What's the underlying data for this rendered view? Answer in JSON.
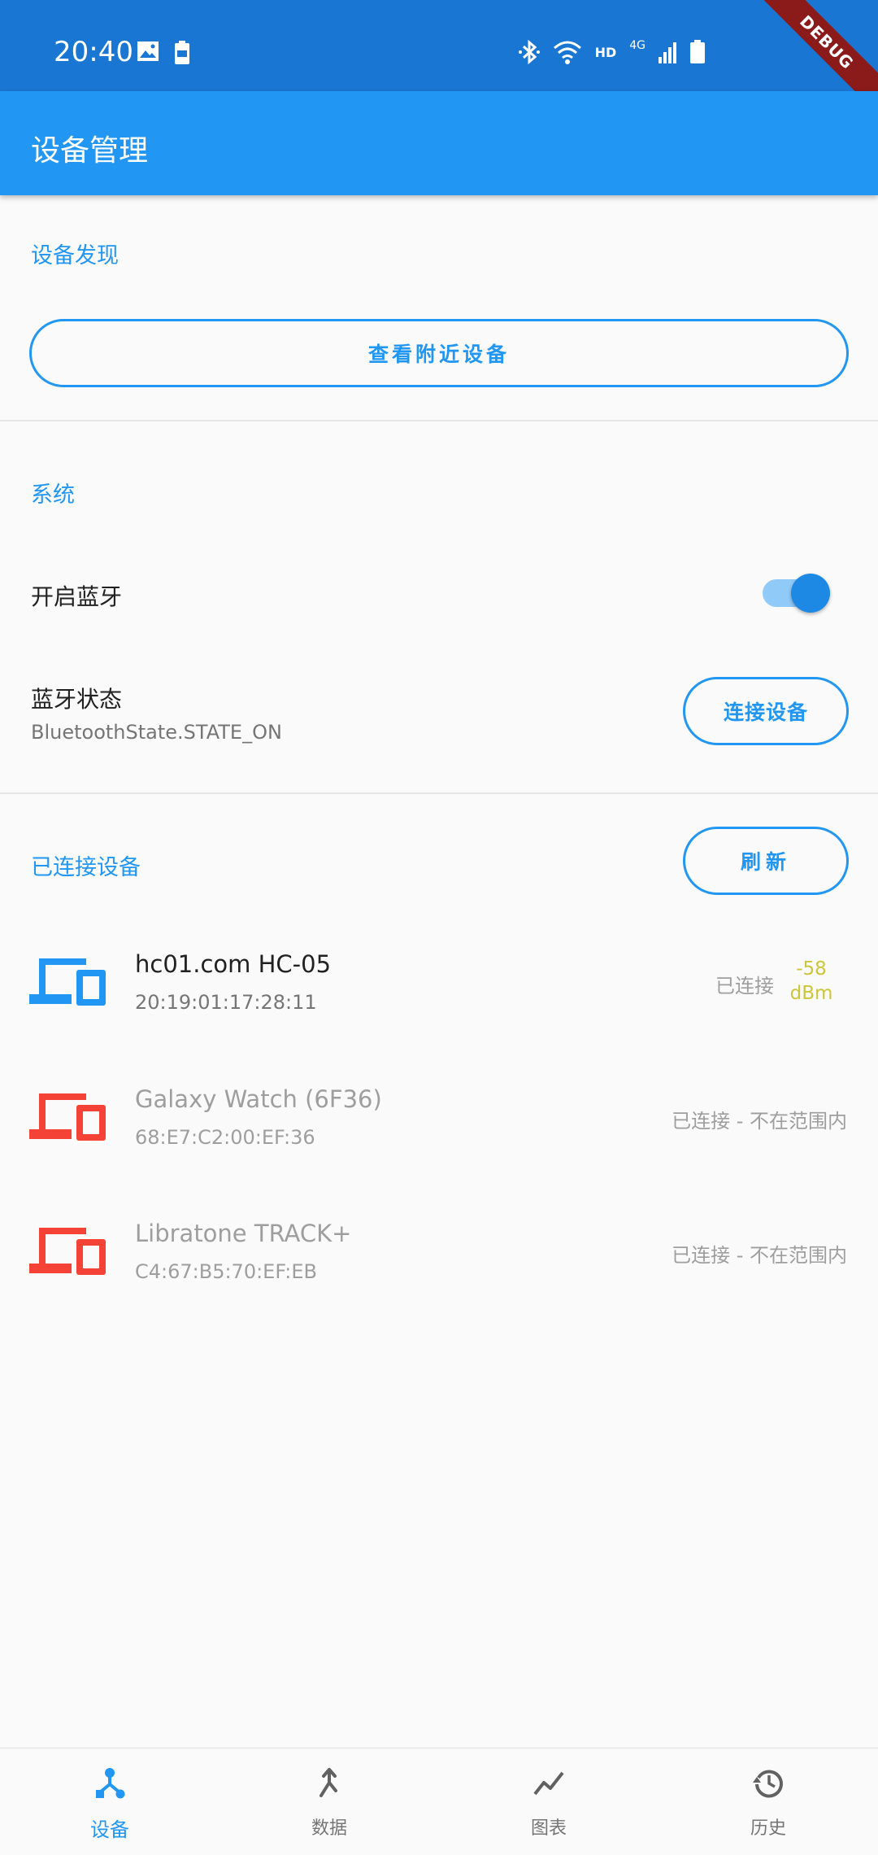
{
  "status_bar": {
    "time": "20:40",
    "left_icons": [
      "image-icon",
      "battery-saver-icon"
    ],
    "right_icons": [
      "bluetooth-icon",
      "wifi-icon",
      "signal-icon",
      "battery-icon"
    ],
    "network_label": "HD",
    "network_type": "4G",
    "debug_banner": "DEBUG",
    "color": "#1976d2"
  },
  "app_bar": {
    "title": "设备管理",
    "color": "#2196f3"
  },
  "discovery": {
    "header": "设备发现",
    "scan_button": "查看附近设备"
  },
  "system": {
    "header": "系统",
    "bluetooth_toggle_label": "开启蓝牙",
    "bluetooth_enabled": true,
    "bluetooth_state_label": "蓝牙状态",
    "bluetooth_state_value": "BluetoothState.STATE_ON",
    "connect_button": "连接设备"
  },
  "connected": {
    "header": "已连接设备",
    "refresh_button": "刷新",
    "devices": [
      {
        "name": "hc01.com HC-05",
        "mac": "20:19:01:17:28:11",
        "status": "已连接",
        "rssi": "-58",
        "rssi_unit": "dBm",
        "icon": "devices-icon",
        "icon_color": "#2196f3",
        "in_range": true
      },
      {
        "name": "Galaxy Watch (6F36)",
        "mac": "68:E7:C2:00:EF:36",
        "status": "已连接 - 不在范围内",
        "icon": "devices-icon",
        "icon_color": "#f44336",
        "in_range": false
      },
      {
        "name": "Libratone TRACK+",
        "mac": "C4:67:B5:70:EF:EB",
        "status": "已连接 - 不在范围内",
        "icon": "devices-icon",
        "icon_color": "#f44336",
        "in_range": false
      }
    ]
  },
  "bottom_nav": {
    "items": [
      {
        "label": "设备",
        "icon": "device-hub-icon",
        "active": true
      },
      {
        "label": "数据",
        "icon": "merge-icon",
        "active": false
      },
      {
        "label": "图表",
        "icon": "chart-line-icon",
        "active": false
      },
      {
        "label": "历史",
        "icon": "history-icon",
        "active": false
      }
    ],
    "active_color": "#2196f3"
  }
}
